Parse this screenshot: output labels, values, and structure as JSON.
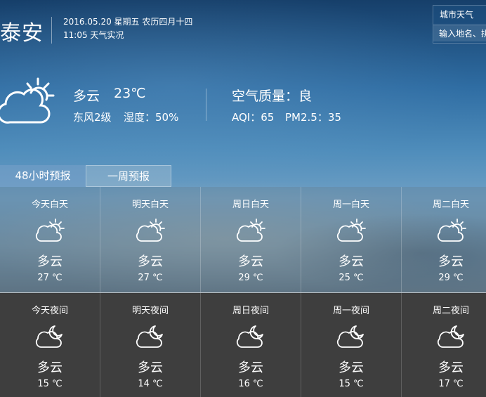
{
  "header": {
    "city": "泰安",
    "date_line": "2016.05.20 星期五 农历四月十四",
    "time_line": "11:05 天气实况"
  },
  "city_weather": {
    "title": "城市天气",
    "placeholder": "输入地名、拼"
  },
  "current": {
    "icon": "partly-cloudy-day-icon",
    "weather": "多云",
    "temp": "23℃",
    "wind": "东风2级",
    "humidity": "湿度：50%"
  },
  "air_quality": {
    "title": "空气质量：良",
    "aqi": "AQI：65",
    "pm25": "PM2.5：35"
  },
  "tabs": [
    {
      "label": "48小时预报"
    },
    {
      "label": "一周预报"
    }
  ],
  "day_forecast": [
    {
      "label": "今天白天",
      "weather": "多云",
      "temp": "27 ℃",
      "icon": "partly-cloudy-day-icon"
    },
    {
      "label": "明天白天",
      "weather": "多云",
      "temp": "27 ℃",
      "icon": "partly-cloudy-day-icon"
    },
    {
      "label": "周日白天",
      "weather": "多云",
      "temp": "29 ℃",
      "icon": "partly-cloudy-day-icon"
    },
    {
      "label": "周一白天",
      "weather": "多云",
      "temp": "25 ℃",
      "icon": "partly-cloudy-day-icon"
    },
    {
      "label": "周二白天",
      "weather": "多云",
      "temp": "29 ℃",
      "icon": "partly-cloudy-day-icon"
    }
  ],
  "night_forecast": [
    {
      "label": "今天夜间",
      "weather": "多云",
      "temp": "15 ℃",
      "icon": "partly-cloudy-night-icon"
    },
    {
      "label": "明天夜间",
      "weather": "多云",
      "temp": "14 ℃",
      "icon": "partly-cloudy-night-icon"
    },
    {
      "label": "周日夜间",
      "weather": "多云",
      "temp": "16 ℃",
      "icon": "partly-cloudy-night-icon"
    },
    {
      "label": "周一夜间",
      "weather": "多云",
      "temp": "15 ℃",
      "icon": "partly-cloudy-night-icon"
    },
    {
      "label": "周二夜间",
      "weather": "多云",
      "temp": "17 ℃",
      "icon": "partly-cloudy-night-icon"
    }
  ],
  "colors": {
    "text": "#ffffff",
    "night_bg": "#3e3e3e"
  }
}
